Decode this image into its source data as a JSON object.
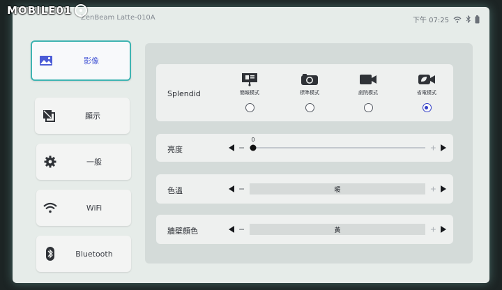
{
  "watermark": "MOBILE01",
  "statusbar": {
    "device_name": "ZenBeam Latte-010A",
    "time": "下午 07:25",
    "icons": [
      "wifi-icon",
      "bluetooth-icon",
      "battery-icon"
    ]
  },
  "sidebar": {
    "items": [
      {
        "label": "影像",
        "icon": "image-icon",
        "active": true
      },
      {
        "label": "顯示",
        "icon": "display-icon",
        "active": false
      },
      {
        "label": "一般",
        "icon": "gear-icon",
        "active": false
      },
      {
        "label": "WiFi",
        "icon": "wifi-icon",
        "active": false
      },
      {
        "label": "Bluetooth",
        "icon": "bluetooth-icon",
        "active": false
      }
    ]
  },
  "splendid": {
    "label": "Splendid",
    "modes": [
      {
        "label": "簡報模式",
        "icon": "presentation-icon",
        "selected": false
      },
      {
        "label": "標準模式",
        "icon": "camera-icon",
        "selected": false
      },
      {
        "label": "劇院模式",
        "icon": "video-camera-icon",
        "selected": false
      },
      {
        "label": "省電模式",
        "icon": "eco-leaf-icon",
        "selected": true
      }
    ]
  },
  "brightness": {
    "label": "亮度",
    "value": "0",
    "level": 0
  },
  "color_temp": {
    "label": "色溫",
    "value": "暖"
  },
  "wall_color": {
    "label": "牆壁顏色",
    "value": "黃"
  },
  "controls": {
    "minus": "−",
    "plus": "+"
  },
  "colors": {
    "accent": "#3fb4b2",
    "active_text": "#4b5bd6",
    "radio_selected": "#3340c8"
  }
}
